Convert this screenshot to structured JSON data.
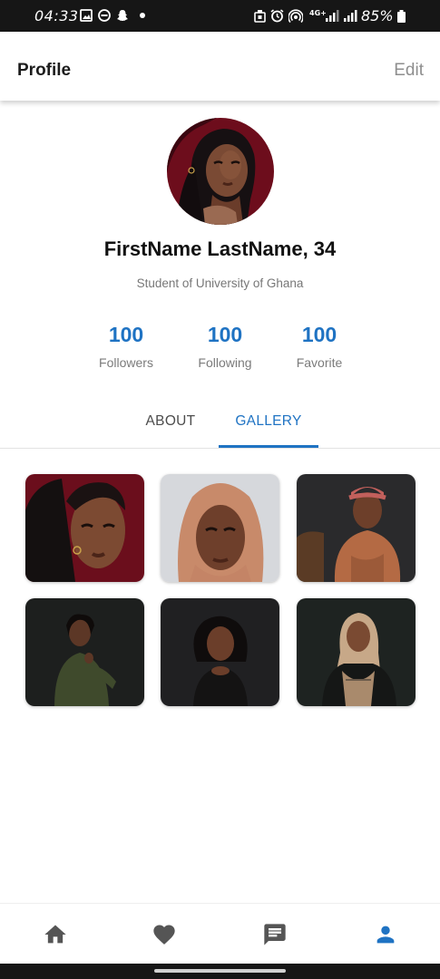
{
  "status_bar": {
    "time": "04:33",
    "network": "4G+",
    "battery": "85%"
  },
  "header": {
    "title": "Profile",
    "edit_label": "Edit"
  },
  "profile": {
    "name": "FirstName LastName, 34",
    "subtitle": "Student of University of Ghana"
  },
  "stats": [
    {
      "value": "100",
      "label": "Followers"
    },
    {
      "value": "100",
      "label": "Following"
    },
    {
      "value": "100",
      "label": "Favorite"
    }
  ],
  "tabs": [
    {
      "label": "ABOUT",
      "active": false
    },
    {
      "label": "GALLERY",
      "active": true
    }
  ],
  "gallery": {
    "count": 6
  },
  "bottom_nav": [
    {
      "icon": "home-icon",
      "active": false
    },
    {
      "icon": "heart-icon",
      "active": false
    },
    {
      "icon": "chat-icon",
      "active": false
    },
    {
      "icon": "person-icon",
      "active": true
    }
  ],
  "colors": {
    "accent": "#1f73c3",
    "inactive_icon": "#555555",
    "status_bar": "#161616"
  }
}
